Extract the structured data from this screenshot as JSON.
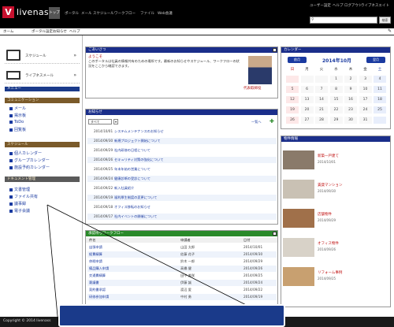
{
  "header": {
    "logo": "V",
    "brand": "livenass",
    "nav_active": "トップ",
    "nav_items": [
      "ポータル",
      "メール",
      "スケジュール",
      "ワークフロー",
      "ファイル",
      "Web会議"
    ],
    "top_links": [
      "ユーザー設定",
      "ヘルプ",
      "ログアウト",
      "ライブネスエイト"
    ],
    "search_placeholder": "",
    "search_button": "検索"
  },
  "subbar": {
    "items": [
      "ホーム",
      "ポータル設定",
      "お知らせ",
      "ヘルプ"
    ]
  },
  "sidebar": {
    "big_apps": [
      {
        "label": "スケジュール"
      },
      {
        "label": "ライブネスメール"
      }
    ],
    "menu_title": "メニュー",
    "sections": [
      {
        "title": "コミュニケーション",
        "items": [
          "メール",
          "掲示板",
          "ToDo",
          "回覧板"
        ]
      },
      {
        "title": "スケジュール",
        "items": [
          "個人カレンダー",
          "グループカレンダー",
          "施設予約カレンダー"
        ]
      },
      {
        "title": "ドキュメント管理",
        "items": [
          "文書管理",
          "ファイル共有",
          "議事録",
          "電子会議"
        ]
      }
    ]
  },
  "greeting": {
    "title": "ごあいさつ",
    "heading": "ようこそ",
    "body": "このポータルは社員の情報共有のための場所です。最新のお知らせやスケジュール、ワークフローの状況をここから確認できます。",
    "name": "代表取締役"
  },
  "notices": {
    "title": "お知らせ",
    "filter": "すべて",
    "more": "一覧へ",
    "rows": [
      {
        "date": "2014/10/01",
        "text": "システムメンテナンスのお知らせ"
      },
      {
        "date": "2014/09/30",
        "text": "新規プロジェクト開始について"
      },
      {
        "date": "2014/09/29",
        "text": "社内研修の日程について"
      },
      {
        "date": "2014/09/26",
        "text": "セキュリティ対策の強化について"
      },
      {
        "date": "2014/09/25",
        "text": "年末年始の営業について"
      },
      {
        "date": "2014/09/24",
        "text": "健康診断の受診について"
      },
      {
        "date": "2014/09/22",
        "text": "新入社員紹介"
      },
      {
        "date": "2014/09/19",
        "text": "福利厚生制度の変更について"
      },
      {
        "date": "2014/09/18",
        "text": "オフィス移転のお知らせ"
      },
      {
        "date": "2014/09/17",
        "text": "社内イベントの開催について"
      }
    ]
  },
  "workflow": {
    "title": "承認待ちワークフロー",
    "columns": [
      "件名",
      "申請者",
      "日付"
    ],
    "rows": [
      {
        "subject": "出張申請",
        "applicant": "山田 太郎",
        "date": "2014/10/01"
      },
      {
        "subject": "経費精算",
        "applicant": "佐藤 花子",
        "date": "2014/09/30"
      },
      {
        "subject": "休暇申請",
        "applicant": "鈴木 一郎",
        "date": "2014/09/29"
      },
      {
        "subject": "備品購入申請",
        "applicant": "高橋 健",
        "date": "2014/09/26"
      },
      {
        "subject": "交通費精算",
        "applicant": "田中 美咲",
        "date": "2014/09/25"
      },
      {
        "subject": "稟議書",
        "applicant": "伊藤 誠",
        "date": "2014/09/24"
      },
      {
        "subject": "契約書承認",
        "applicant": "渡辺 愛",
        "date": "2014/09/22"
      },
      {
        "subject": "研修参加申請",
        "applicant": "中村 勇",
        "date": "2014/09/19"
      }
    ]
  },
  "calendar": {
    "title": "カレンダー",
    "prev": "前月",
    "month": "2014年10月",
    "next": "翌月",
    "weekdays": [
      "日",
      "月",
      "火",
      "水",
      "木",
      "金",
      "土"
    ],
    "weeks": [
      [
        "",
        "",
        "",
        "1",
        "2",
        "3",
        "4"
      ],
      [
        "5",
        "6",
        "7",
        "8",
        "9",
        "10",
        "11"
      ],
      [
        "12",
        "13",
        "14",
        "15",
        "16",
        "17",
        "18"
      ],
      [
        "19",
        "20",
        "21",
        "22",
        "23",
        "24",
        "25"
      ],
      [
        "26",
        "27",
        "28",
        "29",
        "30",
        "31",
        ""
      ]
    ]
  },
  "gallery": {
    "title": "物件情報",
    "items": [
      {
        "title": "新築一戸建て",
        "meta": "2014/10/01"
      },
      {
        "title": "賃貸マンション",
        "meta": "2014/09/30"
      },
      {
        "title": "店舗物件",
        "meta": "2014/09/29"
      },
      {
        "title": "オフィス物件",
        "meta": "2014/09/26"
      },
      {
        "title": "リフォーム事例",
        "meta": "2014/09/25"
      }
    ]
  },
  "footer": {
    "copyright": "Copyright © 2014 livenass"
  },
  "colors": {
    "header": "#000000",
    "panel_blue": "#1a2e8a",
    "panel_green": "#2a8a2a",
    "menu_brown": "#7a5a2a",
    "link": "#1a3aa0",
    "callout": "#1a3a8a"
  }
}
